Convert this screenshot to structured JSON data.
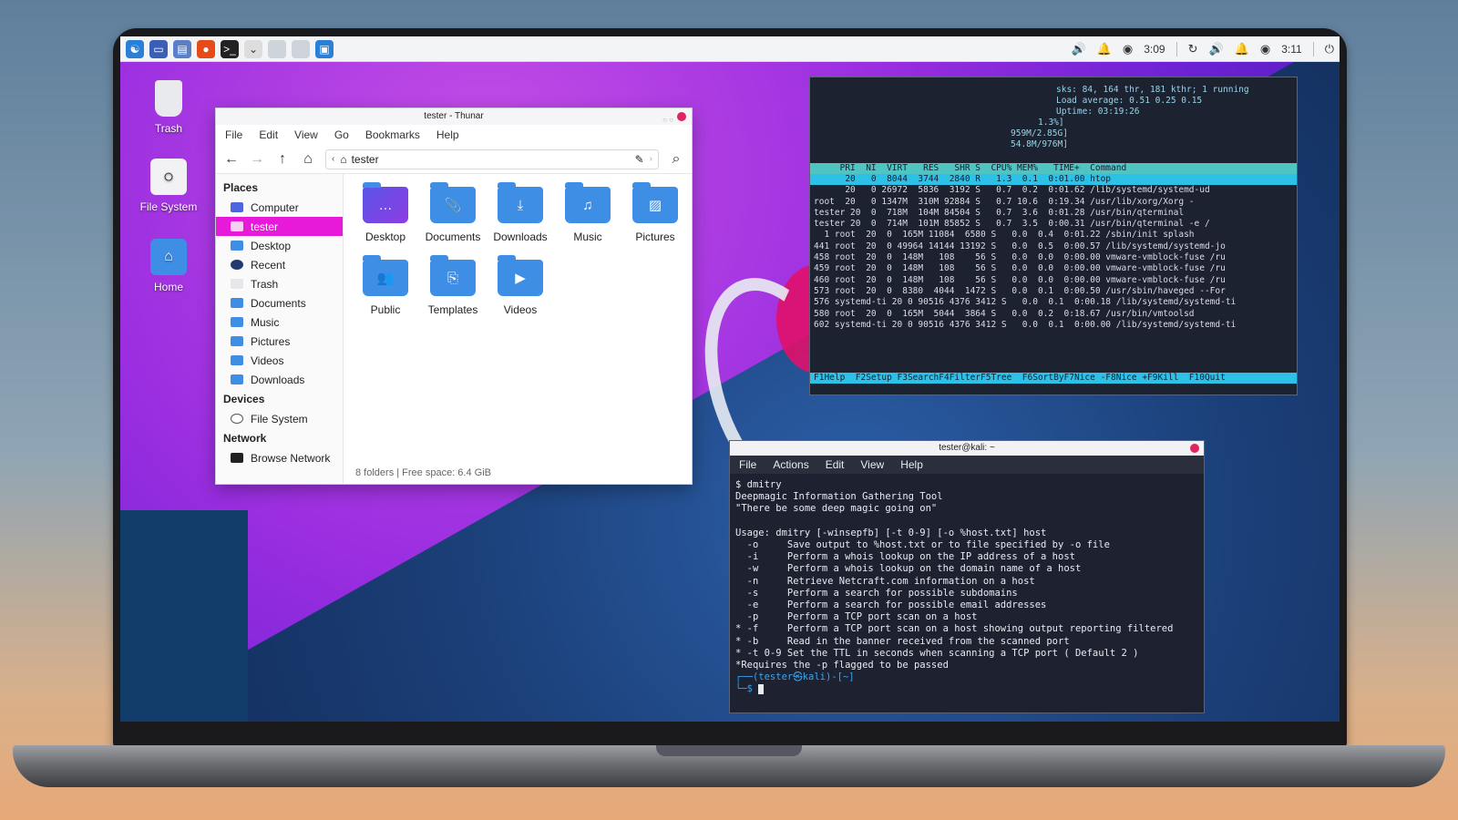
{
  "panel": {
    "clock_left": "3:09",
    "clock_right": "3:11"
  },
  "desktop_icons": [
    {
      "label": "Trash"
    },
    {
      "label": "File System"
    },
    {
      "label": "Home"
    }
  ],
  "thunar": {
    "title": "tester - Thunar",
    "menu": [
      "File",
      "Edit",
      "View",
      "Go",
      "Bookmarks",
      "Help"
    ],
    "path": "tester",
    "sidebar": {
      "places_header": "Places",
      "places": [
        "Computer",
        "tester",
        "Desktop",
        "Recent",
        "Trash",
        "Documents",
        "Music",
        "Pictures",
        "Videos",
        "Downloads"
      ],
      "devices_header": "Devices",
      "devices": [
        "File System"
      ],
      "network_header": "Network",
      "network": [
        "Browse Network"
      ]
    },
    "folders": [
      "Desktop",
      "Documents",
      "Downloads",
      "Music",
      "Pictures",
      "Public",
      "Templates",
      "Videos"
    ],
    "status": "8 folders  |  Free space: 6.4 GiB"
  },
  "htop": {
    "header": [
      "sks: 84, 164 thr, 181 kthr; 1 running",
      "Load average: 0.51 0.25 0.15",
      "Uptime: 03:19:26",
      "1.3%]",
      "959M/2.85G]",
      "54.8M/976M]"
    ],
    "columns": "     PRI  NI  VIRT   RES   SHR S  CPU% MEM%   TIME+  Command",
    "rows": [
      "      20   0  8044  3744  2840 R   1.3  0.1  0:01.00 htop",
      "      20   0 26972  5836  3192 S   0.7  0.2  0:01.62 /lib/systemd/systemd-ud",
      "root  20   0 1347M  310M 92884 S   0.7 10.6  0:19.34 /usr/lib/xorg/Xorg -",
      "tester 20  0  718M  104M 84504 S   0.7  3.6  0:01.28 /usr/bin/qterminal",
      "tester 20  0  714M  101M 85852 S   0.7  3.5  0:00.31 /usr/bin/qterminal -e /",
      "  1 root  20  0  165M 11084  6580 S   0.0  0.4  0:01.22 /sbin/init splash",
      "441 root  20  0 49964 14144 13192 S   0.0  0.5  0:00.57 /lib/systemd/systemd-jo",
      "458 root  20  0  148M   108    56 S   0.0  0.0  0:00.00 vmware-vmblock-fuse /ru",
      "459 root  20  0  148M   108    56 S   0.0  0.0  0:00.00 vmware-vmblock-fuse /ru",
      "460 root  20  0  148M   108    56 S   0.0  0.0  0:00.00 vmware-vmblock-fuse /ru",
      "573 root  20  0  8380  4044  1472 S   0.0  0.1  0:00.50 /usr/sbin/haveged --For",
      "576 systemd-ti 20 0 90516 4376 3412 S   0.0  0.1  0:00.18 /lib/systemd/systemd-ti",
      "580 root  20  0  165M  5044  3864 S   0.0  0.2  0:18.67 /usr/bin/vmtoolsd",
      "602 systemd-ti 20 0 90516 4376 3412 S   0.0  0.1  0:00.00 /lib/systemd/systemd-ti"
    ],
    "fkeys": "F1Help  F2Setup F3SearchF4FilterF5Tree  F6SortByF7Nice -F8Nice +F9Kill  F10Quit"
  },
  "terminal": {
    "title": "tester@kali: ~",
    "menu": [
      "File",
      "Actions",
      "Edit",
      "View",
      "Help"
    ],
    "lines": [
      "$ dmitry",
      "Deepmagic Information Gathering Tool",
      "\"There be some deep magic going on\"",
      "",
      "Usage: dmitry [-winsepfb] [-t 0-9] [-o %host.txt] host",
      "  -o     Save output to %host.txt or to file specified by -o file",
      "  -i     Perform a whois lookup on the IP address of a host",
      "  -w     Perform a whois lookup on the domain name of a host",
      "  -n     Retrieve Netcraft.com information on a host",
      "  -s     Perform a search for possible subdomains",
      "  -e     Perform a search for possible email addresses",
      "  -p     Perform a TCP port scan on a host",
      "* -f     Perform a TCP port scan on a host showing output reporting filtered",
      "* -b     Read in the banner received from the scanned port",
      "* -t 0-9 Set the TTL in seconds when scanning a TCP port ( Default 2 )",
      "*Requires the -p flagged to be passed"
    ],
    "prompt_line1": "┌──(tester㉿kali)-[~]",
    "prompt_line2": "└─$ "
  }
}
